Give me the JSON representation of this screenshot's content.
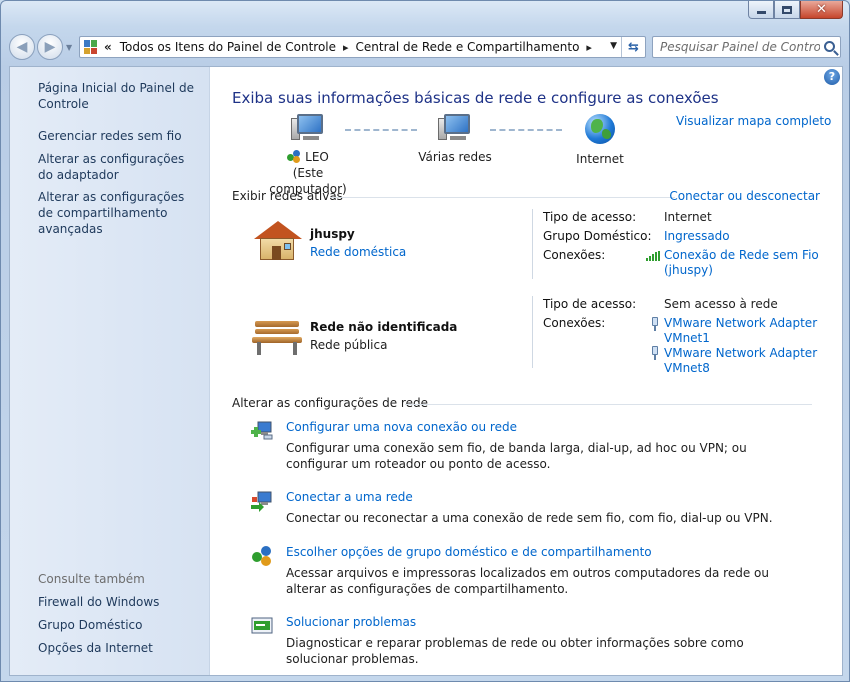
{
  "window": {
    "caption_min": "minimize",
    "caption_max": "maximize",
    "caption_close": "close"
  },
  "address": {
    "chevron": "«",
    "segments": [
      "Todos os Itens do Painel de Controle",
      "Central de Rede e Compartilhamento"
    ],
    "separator": "▸"
  },
  "search": {
    "placeholder": "Pesquisar Painel de Controle"
  },
  "sidebar": {
    "links": [
      "Página Inicial do Painel de Controle",
      "Gerenciar redes sem fio",
      "Alterar as configurações do adaptador",
      "Alterar as configurações de compartilhamento avançadas"
    ],
    "see_also_title": "Consulte também",
    "see_also": [
      "Firewall do Windows",
      "Grupo Doméstico",
      "Opções da Internet"
    ]
  },
  "main": {
    "headline": "Exiba suas informações básicas de rede e configure as conexões",
    "view_full_map": "Visualizar mapa completo",
    "map": {
      "computer_name": "LEO",
      "computer_sub": "(Este computador)",
      "middle": "Várias redes",
      "internet": "Internet"
    },
    "active_networks_title": "Exibir redes ativas",
    "connect_disconnect": "Conectar ou desconectar",
    "networks": [
      {
        "name": "jhuspy",
        "type": "Rede doméstica",
        "access_type_label": "Tipo de acesso:",
        "access_type": "Internet",
        "homegroup_label": "Grupo Doméstico:",
        "homegroup": "Ingressado",
        "connections_label": "Conexões:",
        "connections": [
          "Conexão de Rede sem Fio (jhuspy)"
        ]
      },
      {
        "name": "Rede não identificada",
        "type": "Rede pública",
        "access_type_label": "Tipo de acesso:",
        "access_type": "Sem acesso à rede",
        "connections_label": "Conexões:",
        "connections": [
          "VMware Network Adapter VMnet1",
          "VMware Network Adapter VMnet8"
        ]
      }
    ],
    "change_settings_title": "Alterar as configurações de rede",
    "tasks": [
      {
        "title": "Configurar uma nova conexão ou rede",
        "desc": "Configurar uma conexão sem fio, de banda larga, dial-up, ad hoc ou VPN; ou configurar um roteador ou ponto de acesso.",
        "icon": "new-connection-icon"
      },
      {
        "title": "Conectar a uma rede",
        "desc": "Conectar ou reconectar a uma conexão de rede sem fio, com fio, dial-up ou VPN.",
        "icon": "connect-network-icon"
      },
      {
        "title": "Escolher opções de grupo doméstico e de compartilhamento",
        "desc": "Acessar arquivos e impressoras localizados em outros computadores da rede ou alterar as configurações de compartilhamento.",
        "icon": "homegroup-icon"
      },
      {
        "title": "Solucionar problemas",
        "desc": "Diagnosticar e reparar problemas de rede ou obter informações sobre como solucionar problemas.",
        "icon": "troubleshoot-icon"
      }
    ],
    "help": "?"
  },
  "colors": {
    "link": "#0066cc",
    "headline": "#1e3287",
    "sidebar_link": "#1e395b",
    "close_button": "#c6452c"
  }
}
